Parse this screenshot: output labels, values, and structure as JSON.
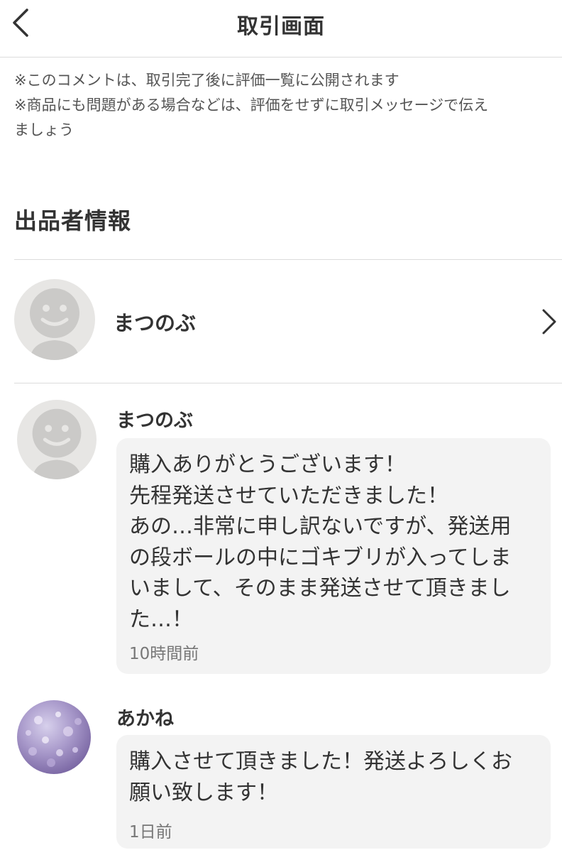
{
  "header": {
    "title": "取引画面"
  },
  "notes": [
    "※このコメントは、取引完了後に評価一覧に公開されます",
    "※商品にも問題がある場合などは、評価をせずに取引メッセージで伝え",
    "ましょう"
  ],
  "seller_section": {
    "title": "出品者情報",
    "seller_name": "まつのぶ"
  },
  "messages": [
    {
      "sender": "まつのぶ",
      "lines": [
        "購入ありがとうございます！",
        "先程発送させていただきました！",
        "あの…非常に申し訳ないですが、発送用",
        "の段ボールの中にゴキブリが入ってしま",
        "いまして、そのまま発送させて頂きまし",
        "た…！"
      ],
      "time": "10時間前"
    },
    {
      "sender": "あかね",
      "lines": [
        "購入させて頂きました！発送よろしくお",
        "願い致します！"
      ],
      "time": "1日前"
    }
  ],
  "colors": {
    "bubble_bg": "#f3f3f3",
    "divider": "#dcdcdc",
    "avatar_default_bg": "#e7e6e4",
    "avatar_default_figure": "#cbcac8"
  }
}
